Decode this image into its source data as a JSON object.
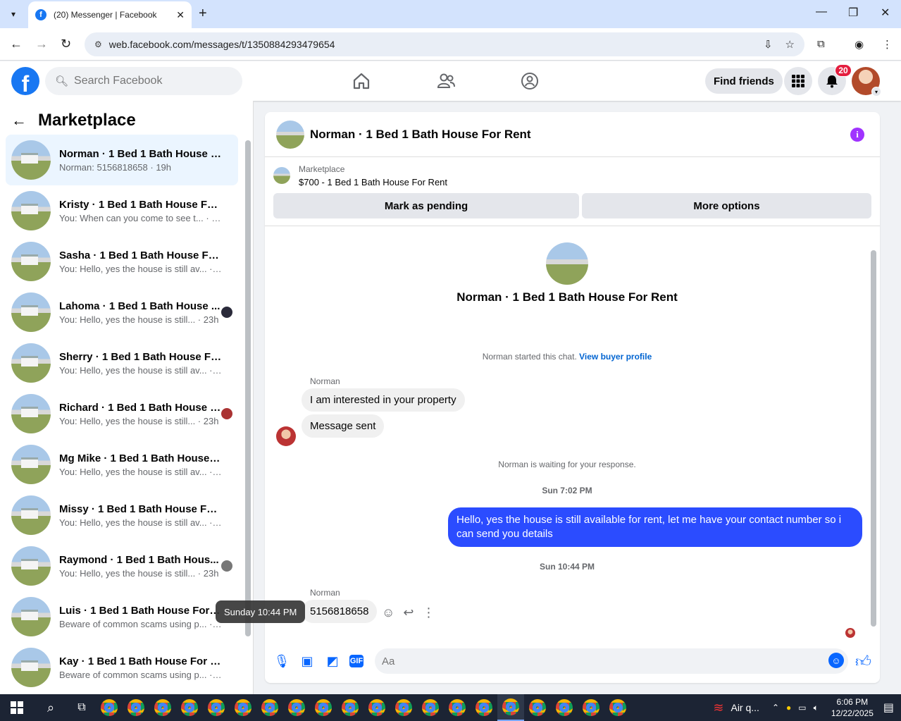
{
  "browser": {
    "tab_title": "(20) Messenger | Facebook",
    "url": "web.facebook.com/messages/t/1350884293479654"
  },
  "fb": {
    "search_placeholder": "Search Facebook",
    "find_friends": "Find friends",
    "notification_count": "20"
  },
  "left": {
    "title": "Marketplace",
    "conversations": [
      {
        "name": "Norman · 1 Bed 1 Bath House Fo...",
        "preview": "Norman: 5156818658 · 19h",
        "active": true
      },
      {
        "name": "Kristy · 1 Bed 1 Bath House For R...",
        "preview": "You: When can you come to see t... · 22h"
      },
      {
        "name": "Sasha · 1 Bed 1 Bath House For R...",
        "preview": "You: Hello, yes the house is still av... · 23h"
      },
      {
        "name": "Lahoma · 1 Bed 1 Bath House ...",
        "preview": "You: Hello, yes the house is still... · 23h"
      },
      {
        "name": "Sherry · 1 Bed 1 Bath House For ...",
        "preview": "You: Hello, yes the house is still av... · 23h"
      },
      {
        "name": "Richard · 1 Bed 1 Bath House F...",
        "preview": "You: Hello, yes the house is still... · 23h"
      },
      {
        "name": "Mg Mike · 1 Bed 1 Bath House F...",
        "preview": "You: Hello, yes the house is still av... · 23h"
      },
      {
        "name": "Missy · 1 Bed 1 Bath House For R...",
        "preview": "You: Hello, yes the house is still av... · 23h"
      },
      {
        "name": "Raymond · 1 Bed 1 Bath Hous...",
        "preview": "You: Hello, yes the house is still... · 23h"
      },
      {
        "name": "Luis · 1 Bed 1 Bath House For Rent",
        "preview": "Beware of common scams using p... · 23h"
      },
      {
        "name": "Kay · 1 Bed 1 Bath House For Rent",
        "preview": "Beware of common scams using p... · 23h"
      }
    ],
    "tooltip": "Sunday 10:44 PM"
  },
  "chat": {
    "title": "Norman · 1 Bed 1 Bath House For Rent",
    "listing_category": "Marketplace",
    "listing_price_title": "$700 - 1 Bed 1 Bath House For Rent",
    "mark_pending": "Mark as pending",
    "more_options": "More options",
    "center_title": "Norman · 1 Bed 1 Bath House For Rent",
    "started_note": "Norman started this chat.",
    "view_buyer_profile": "View buyer profile",
    "sender1": "Norman",
    "msg1": "I am interested in your property",
    "msg2": "Message sent",
    "waiting_note": "Norman is waiting for your response.",
    "time1": "Sun 7:02 PM",
    "msg_out": "Hello, yes the house is still available for rent, let me have your contact number so i can send you  details",
    "time2": "Sun 10:44 PM",
    "sender2": "Norman",
    "msg3": "5156818658",
    "composer_placeholder": "Aa"
  },
  "taskbar": {
    "air": "Air q...",
    "time": "6:06 PM",
    "date": "12/22/2025"
  }
}
